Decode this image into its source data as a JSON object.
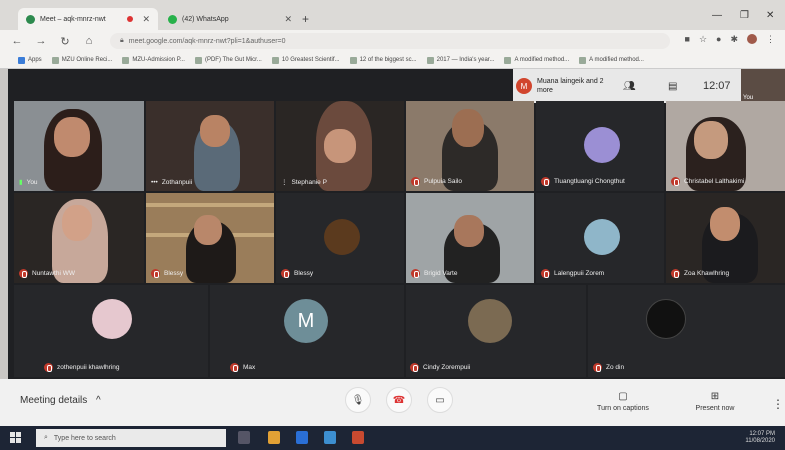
{
  "browser": {
    "tabs": [
      {
        "label": "Meet – aqk-mnrz-nwt",
        "icon": "meet-icon"
      },
      {
        "label": "(42) WhatsApp",
        "icon": "whatsapp-icon"
      }
    ],
    "url": "meet.google.com/aqk-mnrz-nwt?pli=1&authuser=0",
    "bookmarks": [
      "Apps",
      "MZU Online Reci...",
      "MZU-Admission P...",
      "(PDF) The Gut Micr...",
      "10 Greatest Scientif...",
      "12 of the biggest sc...",
      "2017 — India's year...",
      "A modified method...",
      "A modified method..."
    ]
  },
  "meet": {
    "presenter": {
      "initial": "M",
      "text": "Muana laingeik and 2 more"
    },
    "clock": "12:07",
    "self_label": "You",
    "tiles": [
      {
        "name": "You"
      },
      {
        "name": "Zothanpuii"
      },
      {
        "name": "Stephanie P"
      },
      {
        "name": "Pulpuia Sailo"
      },
      {
        "name": "Tluangtluangi Chongthut"
      },
      {
        "name": "Christabel Lalthakimi"
      },
      {
        "name": "Nuntawthi WW"
      },
      {
        "name": "Blessy"
      },
      {
        "name": "Blessy"
      },
      {
        "name": "Brigid Varte"
      },
      {
        "name": "Lalengpuii Zorem"
      },
      {
        "name": "Zoa Khawlhring"
      },
      {
        "name": "zothenpuii khawlhring"
      },
      {
        "name": "Max",
        "initial": "M"
      },
      {
        "name": "Cindy Zorempuii"
      },
      {
        "name": "Zo din"
      }
    ]
  },
  "controls": {
    "meeting_details": "Meeting details",
    "captions": "Turn on captions",
    "present": "Present now"
  },
  "taskbar": {
    "search_placeholder": "Type here to search",
    "time": "12:07 PM",
    "date": "11/08/2020"
  }
}
